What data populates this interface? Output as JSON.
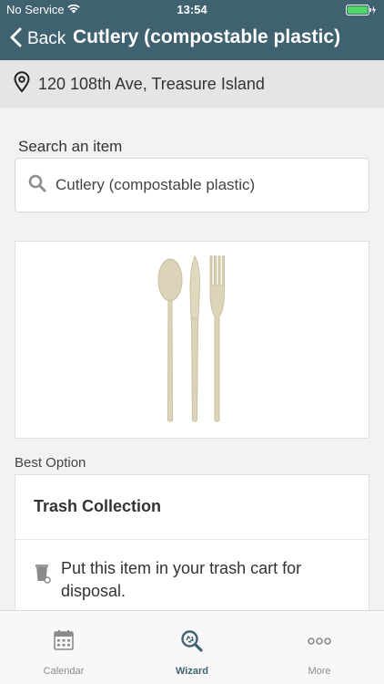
{
  "status_bar": {
    "carrier": "No Service",
    "time": "13:54",
    "icons": [
      "wifi-icon",
      "battery-icon",
      "charging-icon"
    ]
  },
  "nav": {
    "back_label": "Back",
    "title": "Cutlery (compostable plastic)",
    "back_icon": "chevron-left-icon"
  },
  "address": {
    "icon": "map-pin-icon",
    "text": "120 108th Ave, Treasure Island"
  },
  "search": {
    "label": "Search an item",
    "value": "Cutlery (compostable plastic)",
    "icon": "search-icon"
  },
  "item_image": {
    "subject": "compostable cutlery: spoon, knife, fork"
  },
  "best_option": {
    "label": "Best Option",
    "title": "Trash Collection",
    "description": "Put this item in your trash cart for disposal.",
    "icon": "trash-cart-icon"
  },
  "tabs": [
    {
      "label": "Calendar",
      "icon": "calendar-icon",
      "active": false
    },
    {
      "label": "Wizard",
      "icon": "wizard-search-icon",
      "active": true
    },
    {
      "label": "More",
      "icon": "more-dots-icon",
      "active": false
    }
  ],
  "colors": {
    "header": "#3f6170",
    "accent": "#3f6170",
    "battery": "#4cd964"
  }
}
